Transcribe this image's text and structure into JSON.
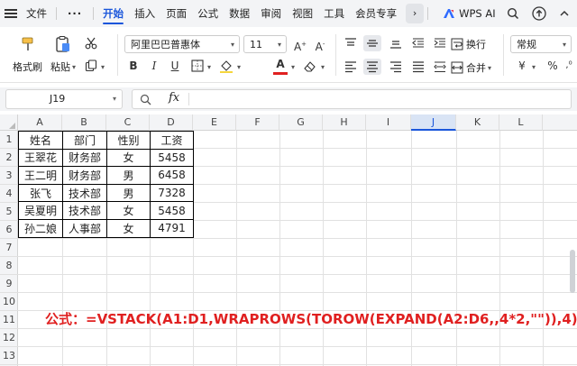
{
  "menubar": {
    "file": "文件",
    "more_dots": "···",
    "tabs": [
      "开始",
      "插入",
      "页面",
      "公式",
      "数据",
      "审阅",
      "视图",
      "工具",
      "会员专享"
    ],
    "more_arrow": "›",
    "wps_ai": "WPS AI"
  },
  "ribbon": {
    "format_painter": "格式刷",
    "paste": "粘贴",
    "font_name": "阿里巴巴普惠体",
    "font_size": "11",
    "bold": "B",
    "italic": "I",
    "underline": "U",
    "font_color_letter": "A",
    "wrap_text": "换行",
    "merge": "合并",
    "number_format": "常规",
    "currency": "¥",
    "percent": "%"
  },
  "formula_bar": {
    "cell_ref": "J19",
    "fx": "fx",
    "content": ""
  },
  "grid": {
    "columns": [
      "A",
      "B",
      "C",
      "D",
      "E",
      "F",
      "G",
      "H",
      "I",
      "J",
      "K",
      "L"
    ],
    "active_column": "J",
    "rows": [
      "1",
      "2",
      "3",
      "4",
      "5",
      "6",
      "7",
      "8",
      "9",
      "10",
      "11",
      "12",
      "13"
    ],
    "table": [
      [
        "姓名",
        "部门",
        "性别",
        "工资"
      ],
      [
        "王翠花",
        "财务部",
        "女",
        "5458"
      ],
      [
        "王二明",
        "财务部",
        "男",
        "6458"
      ],
      [
        "张飞",
        "技术部",
        "男",
        "7328"
      ],
      [
        "吴夏明",
        "技术部",
        "女",
        "5458"
      ],
      [
        "孙二娘",
        "人事部",
        "女",
        "4791"
      ]
    ],
    "formula_note": "公式：=VSTACK(A1:D1,WRAPROWS(TOROW(EXPAND(A2:D6,,4*2,\"\")),4))"
  },
  "colors": {
    "accent": "#1a56db",
    "formula_note": "#e02020",
    "wps_logo_blue": "#2f6bff"
  }
}
